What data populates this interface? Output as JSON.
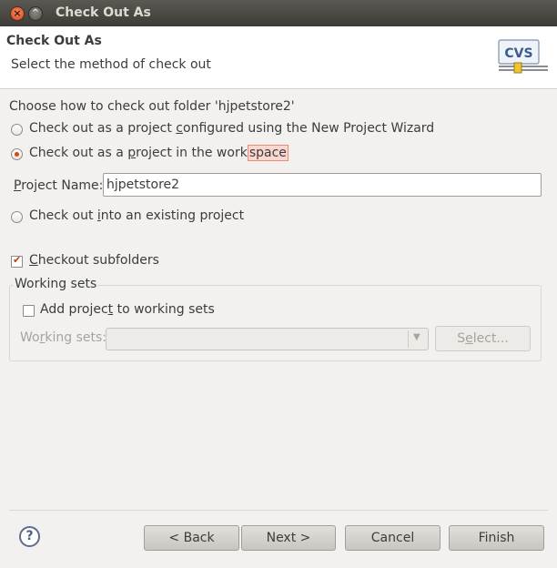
{
  "window": {
    "title": "Check Out As",
    "close_glyph": "×",
    "min_glyph": "^"
  },
  "banner": {
    "title": "Check Out As",
    "subtitle": "Select the method of check out",
    "logo_text": "CVS"
  },
  "prompt": "Choose how to check out folder 'hjpetstore2'",
  "options": {
    "wizard": {
      "pre": "Check out as a project ",
      "mnemonic": "c",
      "post": "onfigured using the New Project Wizard",
      "selected": false
    },
    "workspace": {
      "pre": "Check out as a ",
      "mnemonic": "p",
      "mid": "roject in the work",
      "hl": "space",
      "selected": true
    },
    "existing": {
      "pre": "Check out ",
      "mnemonic": "i",
      "post": "nto an existing project",
      "selected": false
    }
  },
  "project_name": {
    "mnemonic": "P",
    "label_rest": "roject Name:",
    "value": "hjpetstore2"
  },
  "checkout_subfolders": {
    "mnemonic": "C",
    "label_rest": "heckout subfolders",
    "checked": true
  },
  "working_sets": {
    "group_label": "Working sets",
    "add_pre": "Add projec",
    "add_mnemonic": "t",
    "add_post": " to working sets",
    "add_checked": false,
    "sets_pre": "Wo",
    "sets_mnemonic": "r",
    "sets_post": "king sets:",
    "combo_value": "",
    "select_pre": "S",
    "select_mnemonic": "e",
    "select_post": "lect..."
  },
  "buttons": {
    "help_glyph": "?",
    "back": "< Back",
    "next": "Next >",
    "cancel": "Cancel",
    "finish": "Finish"
  },
  "colors": {
    "accent": "#d14a16",
    "title_bar": "#3c3b37"
  }
}
